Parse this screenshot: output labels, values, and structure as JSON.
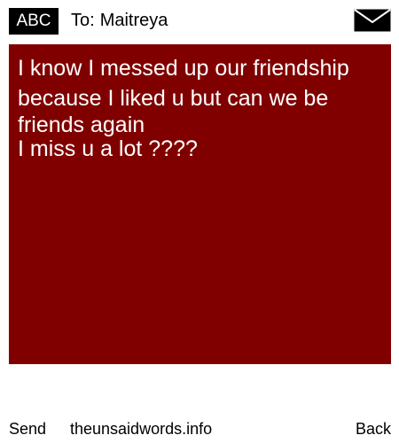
{
  "header": {
    "input_mode": "ABC",
    "to_label": "To:",
    "recipient": "Maitreya",
    "icon": "envelope-icon"
  },
  "message": {
    "lines": [
      "I know I messed up our friendship",
      "because I liked u but can we be",
      "friends again",
      "I miss u a lot ????"
    ],
    "background_color": "#800000",
    "text_color": "#ffffff"
  },
  "footer": {
    "send_label": "Send",
    "site": "theunsaidwords.info",
    "back_label": "Back"
  }
}
